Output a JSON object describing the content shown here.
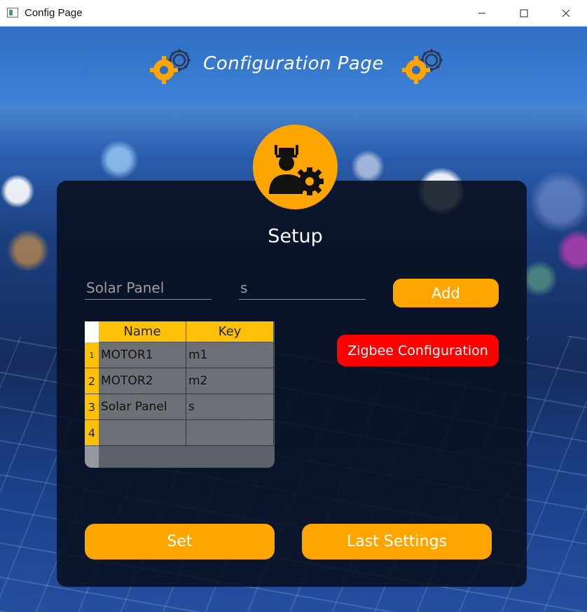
{
  "window": {
    "title": "Config Page",
    "controls": {
      "minimize": "—",
      "maximize": "☐",
      "close": "✕"
    }
  },
  "header": {
    "title": "Configuration Page",
    "icon": "gear-icon"
  },
  "card": {
    "avatar_icon": "engineer-gear-icon",
    "title": "Setup",
    "name_input": {
      "value": "Solar Panel",
      "placeholder": ""
    },
    "key_input": {
      "value": "s",
      "placeholder": ""
    },
    "add_label": "Add",
    "zigbee_label": "Zigbee Configuration",
    "set_label": "Set",
    "last_settings_label": "Last Settings"
  },
  "table": {
    "columns": [
      "Name",
      "Key"
    ],
    "rows": [
      {
        "num": "1",
        "name": "MOTOR1",
        "key": "m1"
      },
      {
        "num": "2",
        "name": "MOTOR2",
        "key": "m2"
      },
      {
        "num": "3",
        "name": "Solar Panel",
        "key": "s"
      },
      {
        "num": "4",
        "name": "",
        "key": ""
      }
    ]
  },
  "colors": {
    "accent": "#ffa500",
    "danger": "#ff0000",
    "header_cell": "#ffc107",
    "card_bg": "#080e1c"
  }
}
